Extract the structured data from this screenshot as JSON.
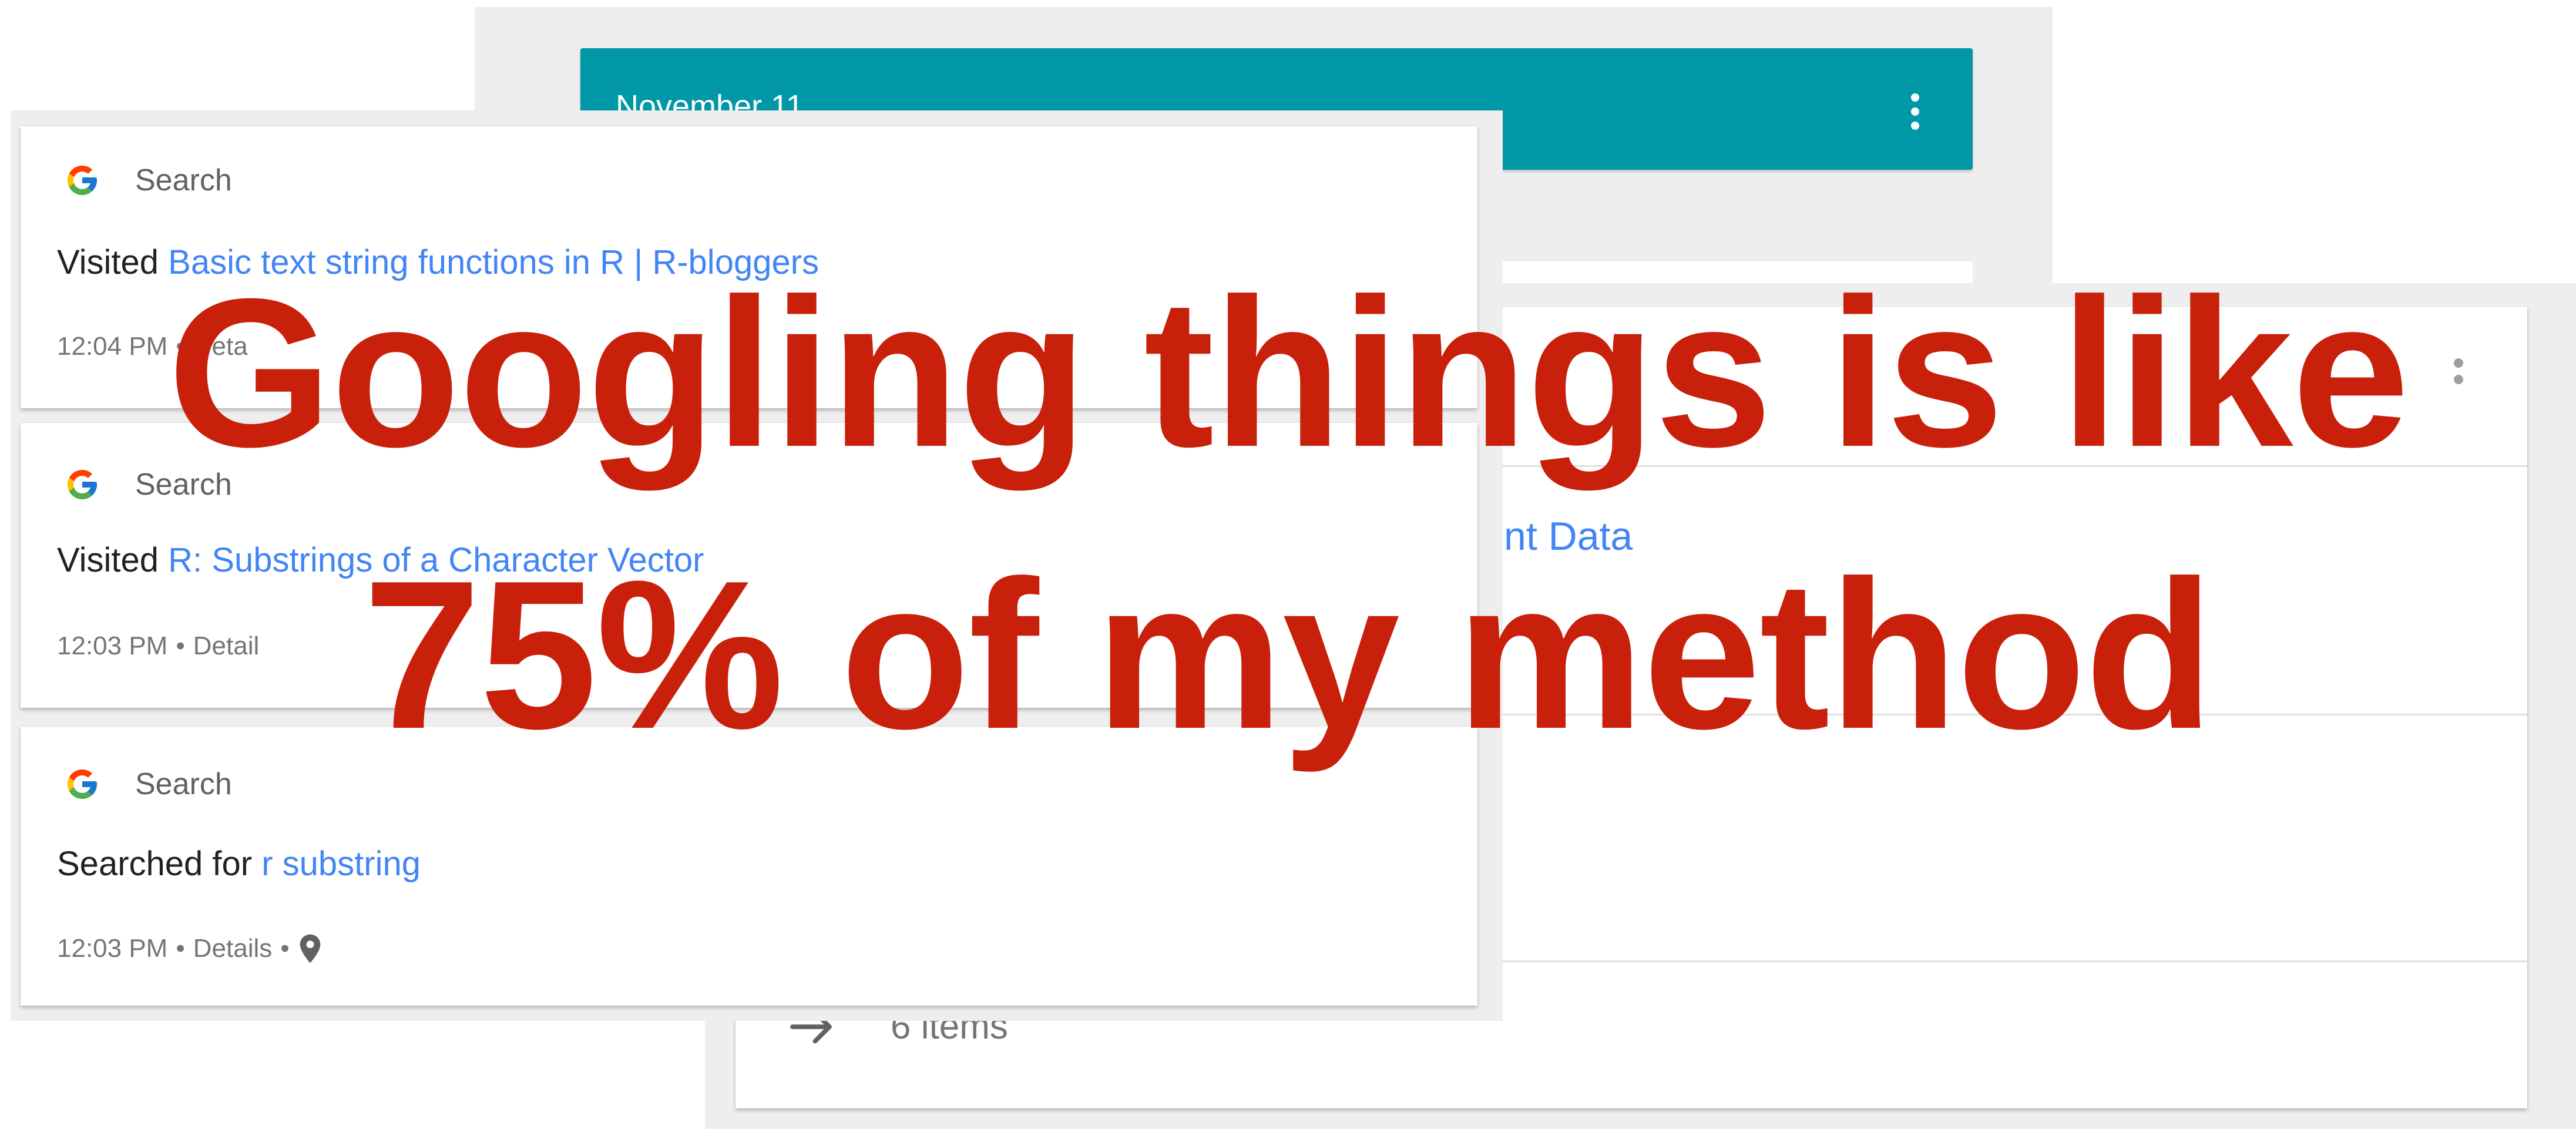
{
  "timeline": {
    "date_header": "November 11",
    "colors": {
      "header_bg": "#0097a7",
      "link": "#4285f4",
      "overlay_text": "#c8200a"
    }
  },
  "back_card": {
    "partial_link": "nt Data",
    "items_count": "6 items",
    "arrow_icon": "arrow-right-icon"
  },
  "activities": [
    {
      "source": "Search",
      "action": "Visited",
      "link": "Basic text string functions in R | R-bloggers",
      "time": "12:04 PM",
      "details": "Deta"
    },
    {
      "source": "Search",
      "action": "Visited",
      "link": "R: Substrings of a Character Vector",
      "time": "12:03 PM",
      "details": "Detail"
    },
    {
      "source": "Search",
      "action": "Searched for",
      "link": "r substring",
      "time": "12:03 PM",
      "details": "Details",
      "location_icon": "location-pin-icon"
    }
  ],
  "meta_separator": "•",
  "overlay": {
    "line1": "Googling things is like",
    "line2": "75% of my method"
  }
}
